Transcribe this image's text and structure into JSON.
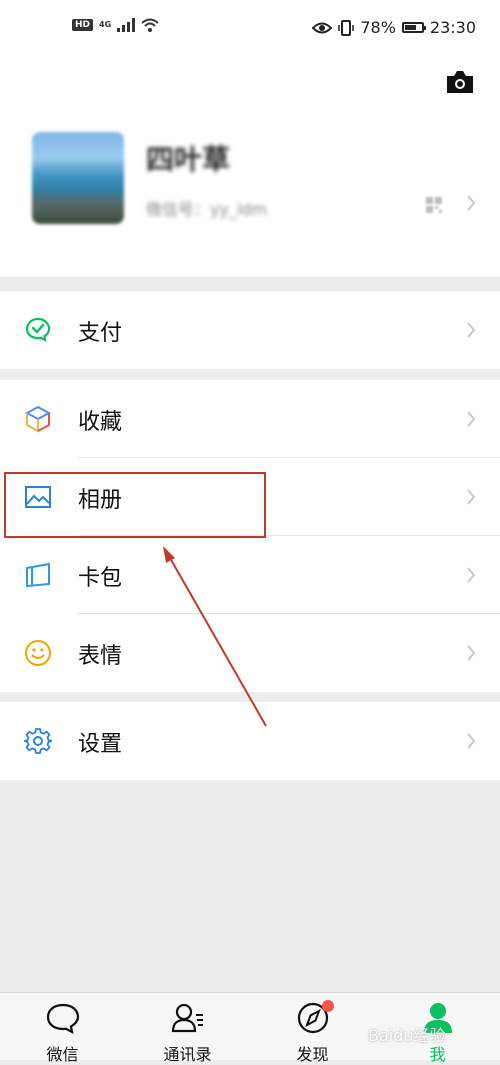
{
  "status_bar": {
    "hd": "HD",
    "network": "4G",
    "battery_percent": "78%",
    "battery_level": 0.78,
    "time": "23:30"
  },
  "profile": {
    "nickname": "四叶草",
    "wechat_id": "微信号：yy_ldm"
  },
  "menu": {
    "pay": {
      "label": "支付",
      "icon": "wechat-pay-icon",
      "color": "#07c160"
    },
    "favorites": {
      "label": "收藏",
      "icon": "cube-icon"
    },
    "album": {
      "label": "相册",
      "icon": "picture-icon",
      "color": "#2b82d9"
    },
    "cards": {
      "label": "卡包",
      "icon": "card-wallet-icon",
      "color": "#2b9dd9"
    },
    "stickers": {
      "label": "表情",
      "icon": "smiley-icon",
      "color": "#f0a500"
    },
    "settings": {
      "label": "设置",
      "icon": "gear-icon",
      "color": "#2b82d9"
    }
  },
  "tabs": [
    {
      "label": "微信",
      "icon": "chat-bubble-icon"
    },
    {
      "label": "通讯录",
      "icon": "contacts-icon"
    },
    {
      "label": "发现",
      "icon": "compass-icon"
    },
    {
      "label": "我",
      "icon": "person-icon",
      "active": true
    }
  ],
  "colors": {
    "accent": "#07c160",
    "annotation": "#c0392b",
    "badge": "#fa5151"
  },
  "watermark": "Baidu经验"
}
